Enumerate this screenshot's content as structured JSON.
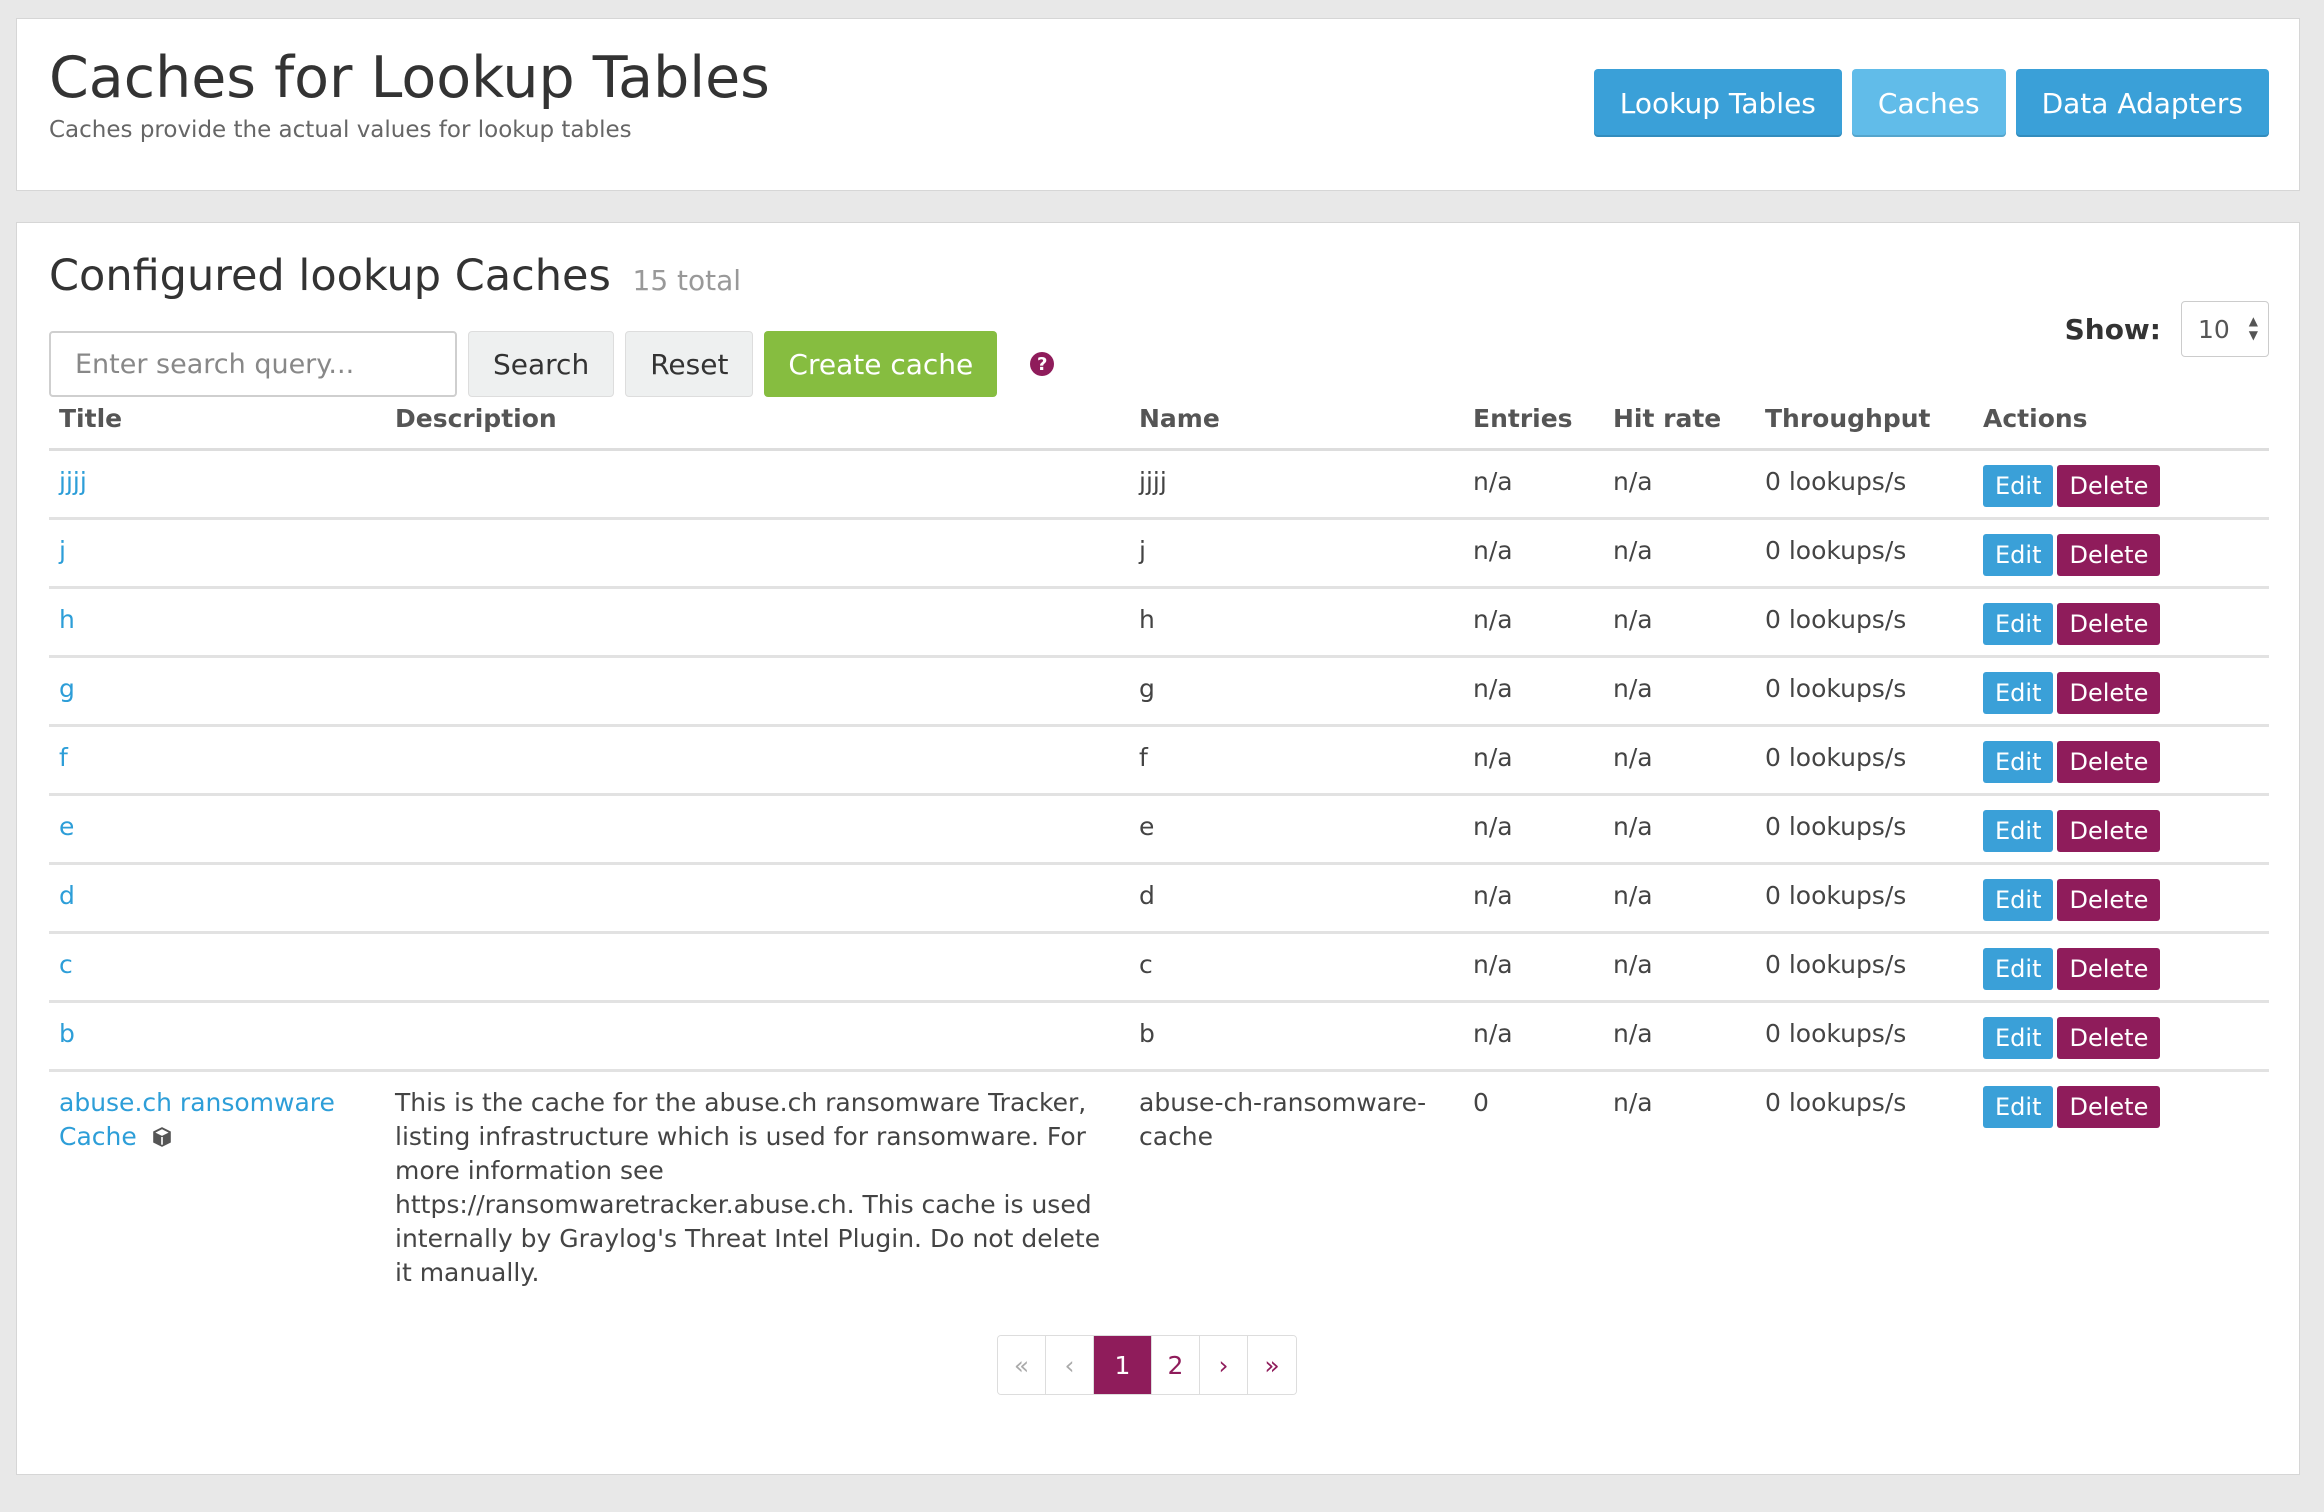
{
  "header": {
    "title": "Caches for Lookup Tables",
    "subtitle": "Caches provide the actual values for lookup tables",
    "nav": [
      "Lookup Tables",
      "Caches",
      "Data Adapters"
    ],
    "active_nav": "Caches"
  },
  "section": {
    "title": "Configured lookup Caches",
    "count": "15 total"
  },
  "toolbar": {
    "search_placeholder": "Enter search query...",
    "search_label": "Search",
    "reset_label": "Reset",
    "create_label": "Create cache",
    "help_icon": "?"
  },
  "show": {
    "label": "Show:",
    "value": "10"
  },
  "table": {
    "columns": [
      "Title",
      "Description",
      "Name",
      "Entries",
      "Hit rate",
      "Throughput",
      "Actions"
    ],
    "rows": [
      {
        "title": "jjjj",
        "description": "",
        "name": "jjjj",
        "entries": "n/a",
        "hit_rate": "n/a",
        "throughput": "0 lookups/s"
      },
      {
        "title": "j",
        "description": "",
        "name": "j",
        "entries": "n/a",
        "hit_rate": "n/a",
        "throughput": "0 lookups/s"
      },
      {
        "title": "h",
        "description": "",
        "name": "h",
        "entries": "n/a",
        "hit_rate": "n/a",
        "throughput": "0 lookups/s"
      },
      {
        "title": "g",
        "description": "",
        "name": "g",
        "entries": "n/a",
        "hit_rate": "n/a",
        "throughput": "0 lookups/s"
      },
      {
        "title": "f",
        "description": "",
        "name": "f",
        "entries": "n/a",
        "hit_rate": "n/a",
        "throughput": "0 lookups/s"
      },
      {
        "title": "e",
        "description": "",
        "name": "e",
        "entries": "n/a",
        "hit_rate": "n/a",
        "throughput": "0 lookups/s"
      },
      {
        "title": "d",
        "description": "",
        "name": "d",
        "entries": "n/a",
        "hit_rate": "n/a",
        "throughput": "0 lookups/s"
      },
      {
        "title": "c",
        "description": "",
        "name": "c",
        "entries": "n/a",
        "hit_rate": "n/a",
        "throughput": "0 lookups/s"
      },
      {
        "title": "b",
        "description": "",
        "name": "b",
        "entries": "n/a",
        "hit_rate": "n/a",
        "throughput": "0 lookups/s"
      },
      {
        "title": "abuse.ch ransomware Cache",
        "description": "This is the cache for the abuse.ch ransomware Tracker, listing infrastructure which is used for ransomware. For more information see https://ransomwaretracker.abuse.ch. This cache is used internally by Graylog's Threat Intel Plugin. Do not delete it manually.",
        "name": "abuse-ch-ransomware-cache",
        "entries": "0",
        "hit_rate": "n/a",
        "throughput": "0 lookups/s",
        "icon": "cube-icon"
      }
    ],
    "edit_label": "Edit",
    "delete_label": "Delete"
  },
  "pagination": {
    "first": "«",
    "prev": "‹",
    "pages": [
      "1",
      "2"
    ],
    "current": "1",
    "next": "›",
    "last": "»"
  },
  "colors": {
    "primary": "#3aa0d8",
    "success": "#86bd40",
    "accent": "#8f1c5b"
  }
}
